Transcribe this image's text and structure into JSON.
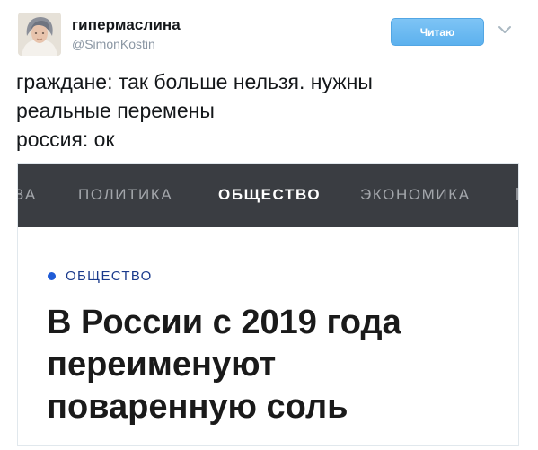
{
  "tweet": {
    "display_name": "гипермаслина",
    "username": "@SimonKostin",
    "follow_label": "Читаю",
    "text_lines": [
      "граждане: так больше нельзя. нужны",
      "реальные перемены",
      "россия: ок"
    ]
  },
  "card": {
    "nav": [
      "ЗА",
      "ПОЛИТИКА",
      "ОБЩЕСТВО",
      "ЭКОНОМИКА"
    ],
    "active_tab": "ОБЩЕСТВО",
    "category": "ОБЩЕСТВО",
    "headline_lines": [
      "В России с 2019 года",
      "переименуют",
      "поваренную соль"
    ]
  },
  "colors": {
    "follow_button": "#5cb1ee",
    "navbar": "#3a3d42",
    "category_dot": "#1f5bd6",
    "category_text": "#1a3a8c"
  },
  "icons": {
    "more_menu": "chevron-down-icon",
    "avatar": "user-avatar"
  }
}
